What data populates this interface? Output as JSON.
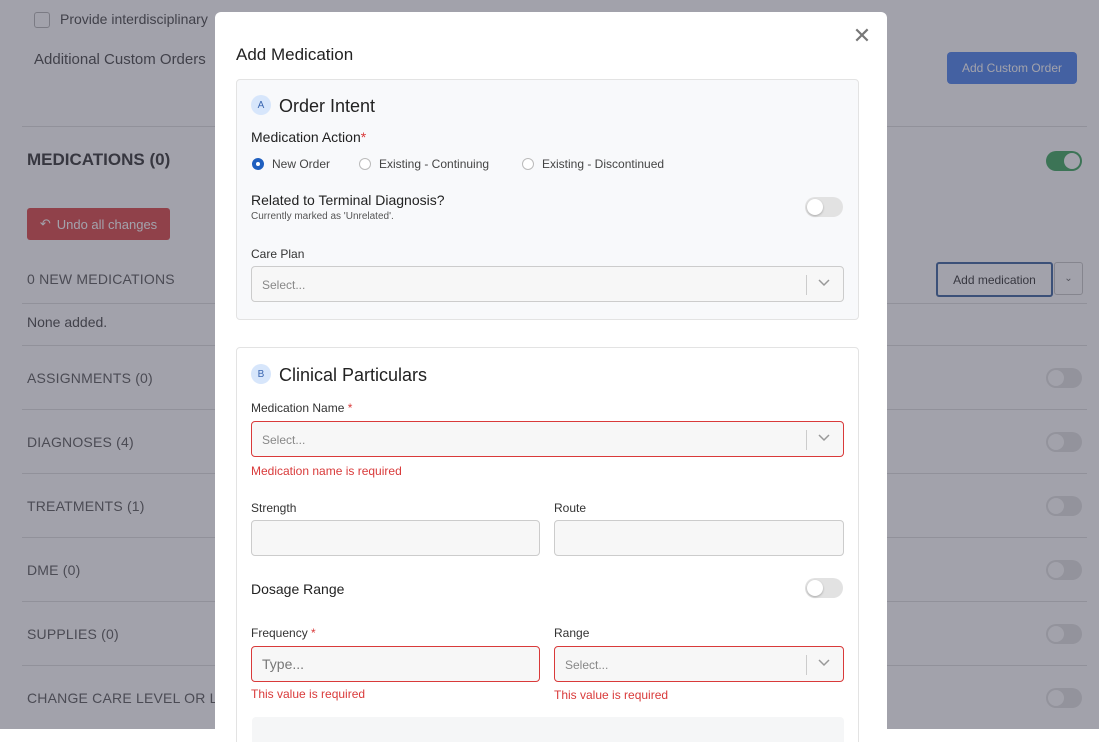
{
  "background": {
    "provide_text": "Provide interdisciplinary",
    "additional_custom_orders": "Additional Custom Orders",
    "add_custom_order_button": "Add Custom Order",
    "medications_header": "MEDICATIONS (0)",
    "undo_button": "Undo all changes",
    "new_medications": "0 NEW MEDICATIONS",
    "add_medication_button": "Add medication",
    "none_added": "None added.",
    "sections": [
      "ASSIGNMENTS (0)",
      "DIAGNOSES (4)",
      "TREATMENTS (1)",
      "DME (0)",
      "SUPPLIES (0)",
      "CHANGE CARE LEVEL OR LO"
    ]
  },
  "modal": {
    "title": "Add Medication",
    "close_icon": "close-icon",
    "section_a": {
      "badge": "A",
      "title": "Order Intent",
      "medication_action_label": "Medication Action",
      "required_mark": "*",
      "radios": [
        "New Order",
        "Existing - Continuing",
        "Existing - Discontinued"
      ],
      "selected_radio": "New Order",
      "terminal_label": "Related to Terminal Diagnosis?",
      "terminal_hint": "Currently marked as 'Unrelated'.",
      "care_plan_label": "Care Plan",
      "care_plan_placeholder": "Select..."
    },
    "section_b": {
      "badge": "B",
      "title": "Clinical Particulars",
      "medication_name_label": "Medication Name",
      "required_mark": "*",
      "medication_name_placeholder": "Select...",
      "medication_name_error": "Medication name is required",
      "strength_label": "Strength",
      "route_label": "Route",
      "dosage_range_label": "Dosage Range",
      "frequency_label": "Frequency",
      "frequency_placeholder": "Type...",
      "frequency_error": "This value is required",
      "range_label": "Range",
      "range_placeholder": "Select...",
      "range_error": "This value is required"
    }
  },
  "colors": {
    "accent": "#1f5fbf",
    "error": "#d93a3a",
    "toggle_on": "#4caf6a"
  }
}
